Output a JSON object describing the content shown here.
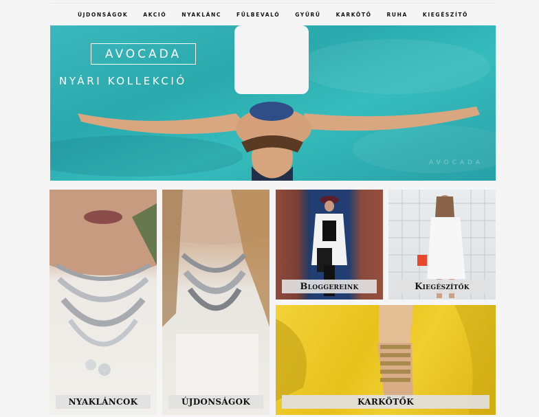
{
  "nav": {
    "items": [
      "ÚJDONSÁGOK",
      "AKCIÓ",
      "NYAKLÁNC",
      "FÜLBEVALÓ",
      "GYŰRŰ",
      "KARKÖTŐ",
      "RUHA",
      "KIEGÉSZÍTŐ"
    ]
  },
  "hero": {
    "logo": "AVOCADA",
    "subtitle": "NYÁRI KOLLEKCIÓ",
    "watermark": "AVOCADA"
  },
  "tiles": {
    "necklaces": {
      "label": "NYAKLÁNCOK"
    },
    "new": {
      "label": "ÚJDONSÁGOK"
    },
    "bloggers": {
      "label": "Bloggereink"
    },
    "accessories": {
      "label": "Kiegészítők"
    },
    "bracelets": {
      "label": "KARKÖTŐK"
    }
  },
  "colors": {
    "hero_water": "#2aa9ad",
    "label_bg": "#e1e1e1",
    "text": "#111111"
  }
}
